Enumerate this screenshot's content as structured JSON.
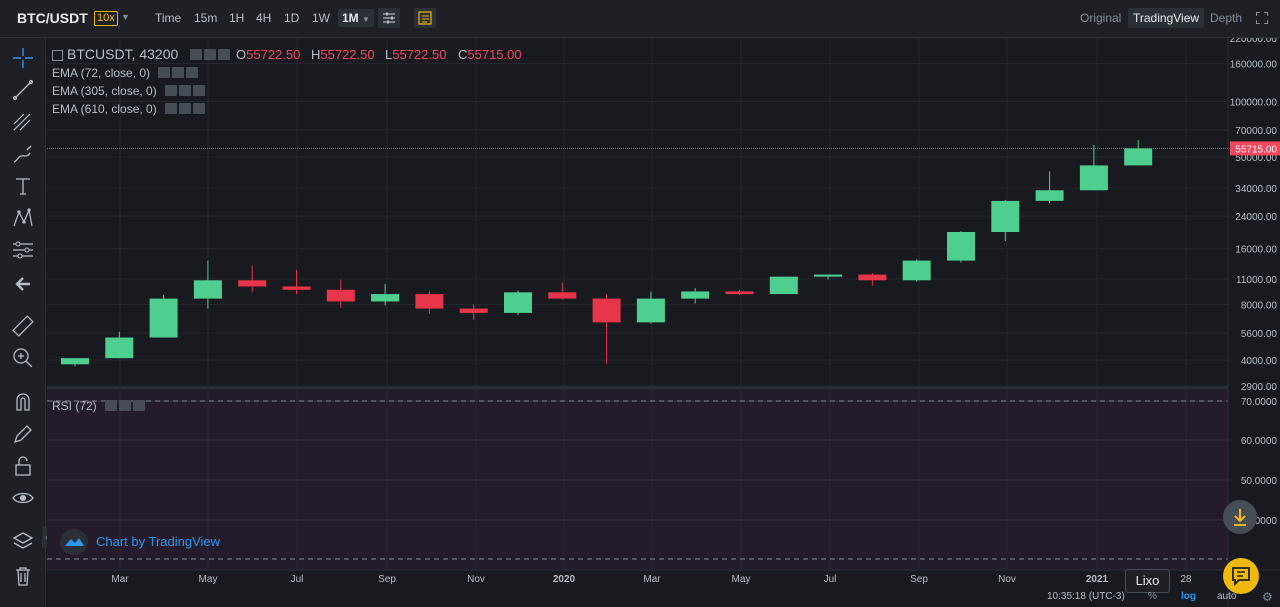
{
  "header": {
    "pair": "BTC/USDT",
    "leverage": "10x",
    "intervals": [
      {
        "label": "Time",
        "active": false
      },
      {
        "label": "15m",
        "active": false
      },
      {
        "label": "1H",
        "active": false
      },
      {
        "label": "4H",
        "active": false
      },
      {
        "label": "1D",
        "active": false
      },
      {
        "label": "1W",
        "active": false
      },
      {
        "label": "1M",
        "active": true
      }
    ],
    "views": [
      {
        "label": "Original",
        "active": false
      },
      {
        "label": "TradingView",
        "active": true
      },
      {
        "label": "Depth",
        "active": false
      }
    ]
  },
  "legend": {
    "symbol": "BTCUSDT, 43200",
    "ohlc": [
      {
        "key": "O",
        "value": "55722.50"
      },
      {
        "key": "H",
        "value": "55722.50"
      },
      {
        "key": "L",
        "value": "55722.50"
      },
      {
        "key": "C",
        "value": "55715.00"
      }
    ],
    "indicators": [
      "EMA (72, close, 0)",
      "EMA (305, close, 0)",
      "EMA (610, close, 0)"
    ],
    "rsi": "RSI (72)"
  },
  "watermark": "Chart by TradingView",
  "tooltip": "Lixo",
  "footer": {
    "clock": "10:35:18 (UTC-3)",
    "percent": "%",
    "log": "log",
    "auto": "auto"
  },
  "colors": {
    "up": "#4fcf8f",
    "down": "#e8354a",
    "price_line": "#f6465d",
    "accent": "#f0b90b"
  },
  "chart_data": {
    "type": "candlestick",
    "scale": "log",
    "last_price": "55715.00",
    "price_ticks": [
      "220000.00",
      "160000.00",
      "100000.00",
      "70000.00",
      "50000.00",
      "34000.00",
      "24000.00",
      "16000.00",
      "11000.00",
      "8000.00",
      "5600.00",
      "4000.00",
      "2900.00"
    ],
    "x_ticks": [
      "Mar",
      "May",
      "Jul",
      "Sep",
      "Nov",
      "2020",
      "Mar",
      "May",
      "Jul",
      "Sep",
      "Nov",
      "2021",
      "28"
    ],
    "rsi_ticks": [
      "70.0000",
      "60.0000",
      "50.0000",
      "40.0000"
    ],
    "candles": [
      {
        "o": 3800,
        "h": 4100,
        "l": 3700,
        "c": 4100
      },
      {
        "o": 4100,
        "h": 5700,
        "l": 4100,
        "c": 5300
      },
      {
        "o": 5300,
        "h": 9000,
        "l": 5300,
        "c": 8600
      },
      {
        "o": 8600,
        "h": 13800,
        "l": 7600,
        "c": 10800
      },
      {
        "o": 10800,
        "h": 13000,
        "l": 9300,
        "c": 10000
      },
      {
        "o": 10000,
        "h": 12300,
        "l": 9100,
        "c": 9600
      },
      {
        "o": 9600,
        "h": 10900,
        "l": 7700,
        "c": 8300
      },
      {
        "o": 8300,
        "h": 10300,
        "l": 7900,
        "c": 9100
      },
      {
        "o": 9100,
        "h": 9500,
        "l": 7100,
        "c": 7600
      },
      {
        "o": 7600,
        "h": 8000,
        "l": 6600,
        "c": 7200
      },
      {
        "o": 7200,
        "h": 9500,
        "l": 7000,
        "c": 9300
      },
      {
        "o": 9300,
        "h": 10500,
        "l": 8500,
        "c": 8600
      },
      {
        "o": 8600,
        "h": 9100,
        "l": 3800,
        "c": 6400
      },
      {
        "o": 6400,
        "h": 9400,
        "l": 6300,
        "c": 8600
      },
      {
        "o": 8600,
        "h": 9800,
        "l": 8100,
        "c": 9400
      },
      {
        "o": 9400,
        "h": 9600,
        "l": 9000,
        "c": 9100
      },
      {
        "o": 9100,
        "h": 11300,
        "l": 9100,
        "c": 11300
      },
      {
        "o": 11300,
        "h": 11600,
        "l": 10900,
        "c": 11600
      },
      {
        "o": 11600,
        "h": 11800,
        "l": 10100,
        "c": 10800
      },
      {
        "o": 10800,
        "h": 14000,
        "l": 10600,
        "c": 13800
      },
      {
        "o": 13800,
        "h": 19900,
        "l": 13500,
        "c": 19700
      },
      {
        "o": 19700,
        "h": 29300,
        "l": 17600,
        "c": 29000
      },
      {
        "o": 29000,
        "h": 41900,
        "l": 28100,
        "c": 33100
      },
      {
        "o": 33100,
        "h": 58300,
        "l": 33000,
        "c": 45100
      },
      {
        "o": 45100,
        "h": 61800,
        "l": 45000,
        "c": 55715
      }
    ]
  }
}
